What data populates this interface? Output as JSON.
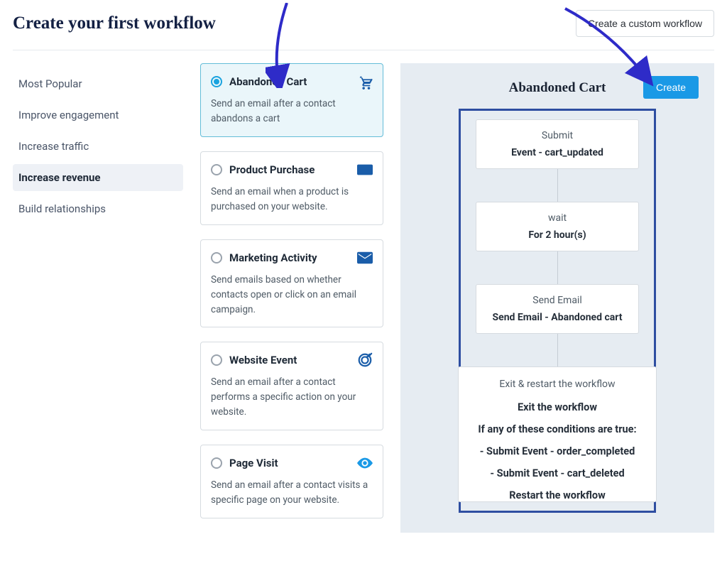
{
  "header": {
    "title": "Create your first workflow",
    "custom_button": "Create a custom workflow"
  },
  "sidebar": {
    "items": [
      {
        "label": "Most Popular"
      },
      {
        "label": "Improve engagement"
      },
      {
        "label": "Increase traffic"
      },
      {
        "label": "Increase revenue"
      },
      {
        "label": "Build relationships"
      }
    ],
    "active_index": 3
  },
  "templates": [
    {
      "title": "Abandoned Cart",
      "desc": "Send an email after a contact abandons a cart",
      "icon": "cart-icon",
      "selected": true
    },
    {
      "title": "Product Purchase",
      "desc": "Send an email when a product is purchased on your website.",
      "icon": "card-icon",
      "selected": false
    },
    {
      "title": "Marketing Activity",
      "desc": "Send emails based on whether contacts open or click on an email campaign.",
      "icon": "mail-icon",
      "selected": false
    },
    {
      "title": "Website Event",
      "desc": "Send an email after a contact performs a specific action on your website.",
      "icon": "target-icon",
      "selected": false
    },
    {
      "title": "Page Visit",
      "desc": "Send an email after a contact visits a specific page on your website.",
      "icon": "eye-icon",
      "selected": false
    }
  ],
  "preview": {
    "title": "Abandoned Cart",
    "create_button": "Create",
    "steps": [
      {
        "label": "Submit",
        "value": "Event - cart_updated"
      },
      {
        "label": "wait",
        "value": "For 2 hour(s)"
      },
      {
        "label": "Send Email",
        "value": "Send Email - Abandoned cart"
      }
    ],
    "exit": {
      "title": "Exit & restart the workflow",
      "heading": "Exit the workflow",
      "condition_intro": "If any of these conditions are true:",
      "conditions": [
        "- Submit Event - order_completed",
        "- Submit Event - cart_deleted"
      ],
      "restart": "Restart the workflow"
    }
  },
  "colors": {
    "accent_blue": "#1a99e6",
    "dark_blue": "#1a5da9",
    "frame_border": "#2e4ea1",
    "selected_bg": "#eaf6fa",
    "panel_bg": "#e6ecf2",
    "arrow_ink": "#2e2bc8"
  }
}
